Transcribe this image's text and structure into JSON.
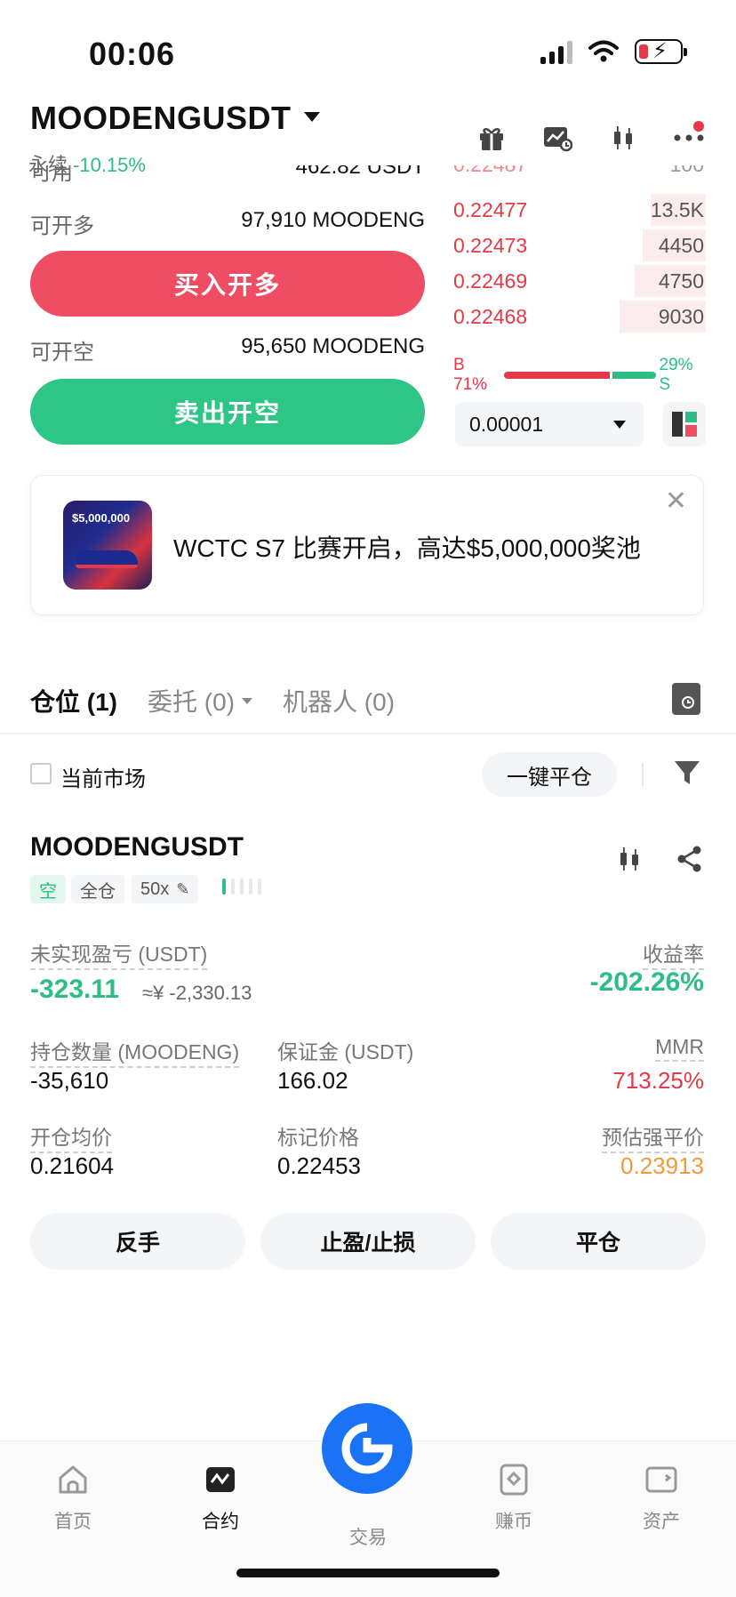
{
  "status_bar": {
    "time": "00:06"
  },
  "header": {
    "pair": "MOODENGUSDT",
    "contract_type": "永续",
    "change": "-10.15%"
  },
  "trade_panel": {
    "available_label": "可用",
    "available_value": "462.82 USDT",
    "long_label": "可开多",
    "long_value": "97,910 MOODENG",
    "buy_button": "买入开多",
    "short_label": "可开空",
    "short_value": "95,650 MOODENG",
    "sell_button": "卖出开空"
  },
  "order_book": {
    "cut_row": {
      "price": "0.22487",
      "qty": "100"
    },
    "asks": [
      {
        "price": "0.22477",
        "qty": "13.5K",
        "depth": 0.22
      },
      {
        "price": "0.22473",
        "qty": "4450",
        "depth": 0.25
      },
      {
        "price": "0.22469",
        "qty": "4750",
        "depth": 0.28
      },
      {
        "price": "0.22468",
        "qty": "9030",
        "depth": 0.34
      }
    ],
    "buy_ratio_label": "B 71%",
    "sell_ratio_label": "29% S",
    "buy_ratio": 0.71,
    "precision": "0.00001"
  },
  "banner": {
    "text": "WCTC S7 比赛开启，高达$5,000,000奖池",
    "image_caption": "$5,000,000"
  },
  "tabs": [
    {
      "label": "仓位 (1)"
    },
    {
      "label": "委托 (0)"
    },
    {
      "label": "机器人 (0)"
    }
  ],
  "filters": {
    "current_market": "当前市场",
    "close_all": "一键平仓"
  },
  "position": {
    "symbol": "MOODENGUSDT",
    "side": "空",
    "margin_mode": "全仓",
    "leverage": "50x",
    "upnl_label": "未实现盈亏 (USDT)",
    "upnl_value": "-323.11",
    "upnl_cny": "≈¥ -2,330.13",
    "roe_label": "收益率",
    "roe_value": "-202.26%",
    "size_label": "持仓数量 (MOODENG)",
    "size_value": "-35,610",
    "margin_label": "保证金 (USDT)",
    "margin_value": "166.02",
    "mmr_label": "MMR",
    "mmr_value": "713.25%",
    "entry_label": "开仓均价",
    "entry_value": "0.21604",
    "mark_label": "标记价格",
    "mark_value": "0.22453",
    "liq_label": "预估强平价",
    "liq_value": "0.23913"
  },
  "actions": {
    "reverse": "反手",
    "tpsl": "止盈/止损",
    "close": "平仓"
  },
  "nav": {
    "home": "首页",
    "contract": "合约",
    "trade": "交易",
    "earn": "赚币",
    "assets": "资产"
  },
  "colors": {
    "buy_red": "#ef4d63",
    "sell_green": "#2dc687",
    "accent_blue": "#1a73f4",
    "liq_orange": "#f29a3a"
  }
}
